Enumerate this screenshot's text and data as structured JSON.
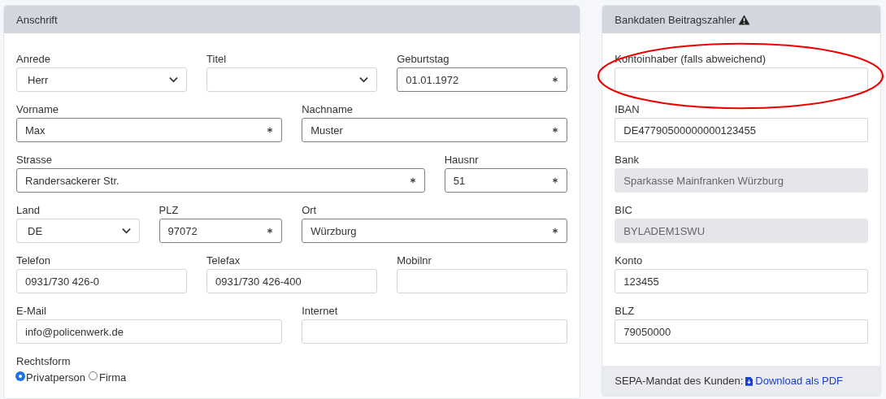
{
  "address": {
    "title": "Anschrift",
    "rows": [
      [
        {
          "label": "Anrede",
          "kind": "select",
          "value": "Herr",
          "required": false
        },
        {
          "label": "Titel",
          "kind": "select",
          "required": false
        },
        {
          "label": "Geburtstag",
          "kind": "input",
          "value": "01.01.1972",
          "required": true
        }
      ],
      [
        {
          "label": "Vorname",
          "kind": "input",
          "value": "Max",
          "required": true
        },
        {
          "label": "Nachname",
          "kind": "input",
          "value": "Muster",
          "required": true
        }
      ],
      [
        {
          "label": "Strasse",
          "kind": "input",
          "value": "Randersackerer Str.",
          "required": true
        },
        {
          "label": "Hausnr",
          "kind": "input",
          "value": "51",
          "required": true
        }
      ],
      [
        {
          "label": "Land",
          "kind": "select",
          "value": "DE",
          "required": false
        },
        {
          "label": "PLZ",
          "kind": "input",
          "value": "97072",
          "required": true
        },
        {
          "label": "Ort",
          "kind": "input",
          "value": "Würzburg",
          "required": true
        }
      ],
      [
        {
          "label": "Telefon",
          "kind": "input",
          "value": "0931/730 426-0",
          "required": false
        },
        {
          "label": "Telefax",
          "kind": "input",
          "value": "0931/730 426-400",
          "required": false
        },
        {
          "label": "Mobilnr",
          "kind": "input",
          "required": false
        }
      ],
      [
        {
          "label": "E-Mail",
          "kind": "input",
          "value": "info@policenwerk.de",
          "required": false
        },
        {
          "label": "Internet",
          "kind": "input",
          "required": false
        }
      ]
    ],
    "legal_form": {
      "label": "Rechtsform",
      "options": [
        {
          "label": "Privatperson",
          "selected": true
        },
        {
          "label": "Firma",
          "selected": false
        }
      ]
    }
  },
  "bank": {
    "title": "Bankdaten Beitragszahler",
    "warning": true,
    "fields": [
      {
        "label": "Kontoinhaber (falls abweichend)",
        "disabled": false,
        "highlighted": true
      },
      {
        "label": "IBAN",
        "value": "DE47790500000000123455",
        "disabled": false
      },
      {
        "label": "Bank",
        "value": "Sparkasse Mainfranken Würzburg",
        "disabled": true
      },
      {
        "label": "BIC",
        "value": "BYLADEM1SWU",
        "disabled": true
      },
      {
        "label": "Konto",
        "value": "123455",
        "disabled": false
      },
      {
        "label": "BLZ",
        "value": "79050000",
        "disabled": false
      }
    ],
    "footer": {
      "text": "SEPA-Mandat des Kunden:",
      "link": "Download als PDF"
    }
  }
}
